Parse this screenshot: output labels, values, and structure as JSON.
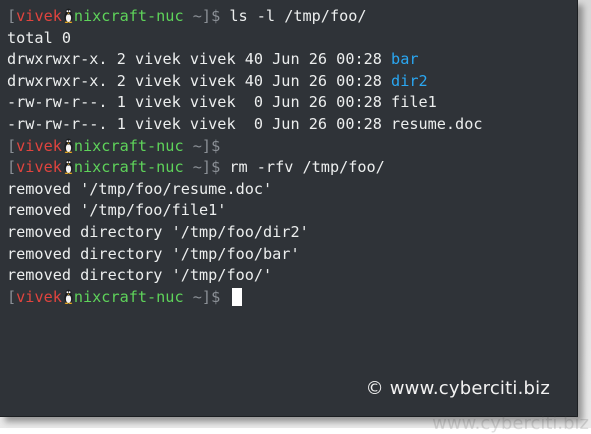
{
  "prompt": {
    "open_bracket": "[",
    "user": "vivek",
    "host": "nixcraft-nuc",
    "path": "~",
    "close_bracket": "]$"
  },
  "lines": [
    {
      "type": "prompt",
      "command": " ls -l /tmp/foo/"
    },
    {
      "type": "output",
      "text": "total 0"
    },
    {
      "type": "ls",
      "prefix": "drwxrwxr-x. 2 vivek vivek 40 Jun 26 00:28 ",
      "name": "bar",
      "is_dir": true
    },
    {
      "type": "ls",
      "prefix": "drwxrwxr-x. 2 vivek vivek 40 Jun 26 00:28 ",
      "name": "dir2",
      "is_dir": true
    },
    {
      "type": "ls",
      "prefix": "-rw-rw-r--. 1 vivek vivek  0 Jun 26 00:28 ",
      "name": "file1",
      "is_dir": false
    },
    {
      "type": "ls",
      "prefix": "-rw-rw-r--. 1 vivek vivek  0 Jun 26 00:28 ",
      "name": "resume.doc",
      "is_dir": false
    },
    {
      "type": "prompt",
      "command": ""
    },
    {
      "type": "prompt",
      "command": " rm -rfv /tmp/foo/"
    },
    {
      "type": "output",
      "text": "removed '/tmp/foo/resume.doc'"
    },
    {
      "type": "output",
      "text": "removed '/tmp/foo/file1'"
    },
    {
      "type": "output",
      "text": "removed directory '/tmp/foo/dir2'"
    },
    {
      "type": "output",
      "text": "removed directory '/tmp/foo/bar'"
    },
    {
      "type": "output",
      "text": "removed directory '/tmp/foo/'"
    },
    {
      "type": "prompt",
      "command": " ",
      "cursor": true
    }
  ],
  "watermark": "© www.cyberciti.biz",
  "watermark_reflection": "www.cyberciti.biz",
  "colors": {
    "background": "#2f3338",
    "text": "#eceeee",
    "user": "#e0443e",
    "host": "#5ed35a",
    "bracket": "#8b9096",
    "directory": "#2aa7f2",
    "cursor": "#ffffff"
  },
  "icons": {
    "prompt_separator": "tux-penguin-icon"
  }
}
